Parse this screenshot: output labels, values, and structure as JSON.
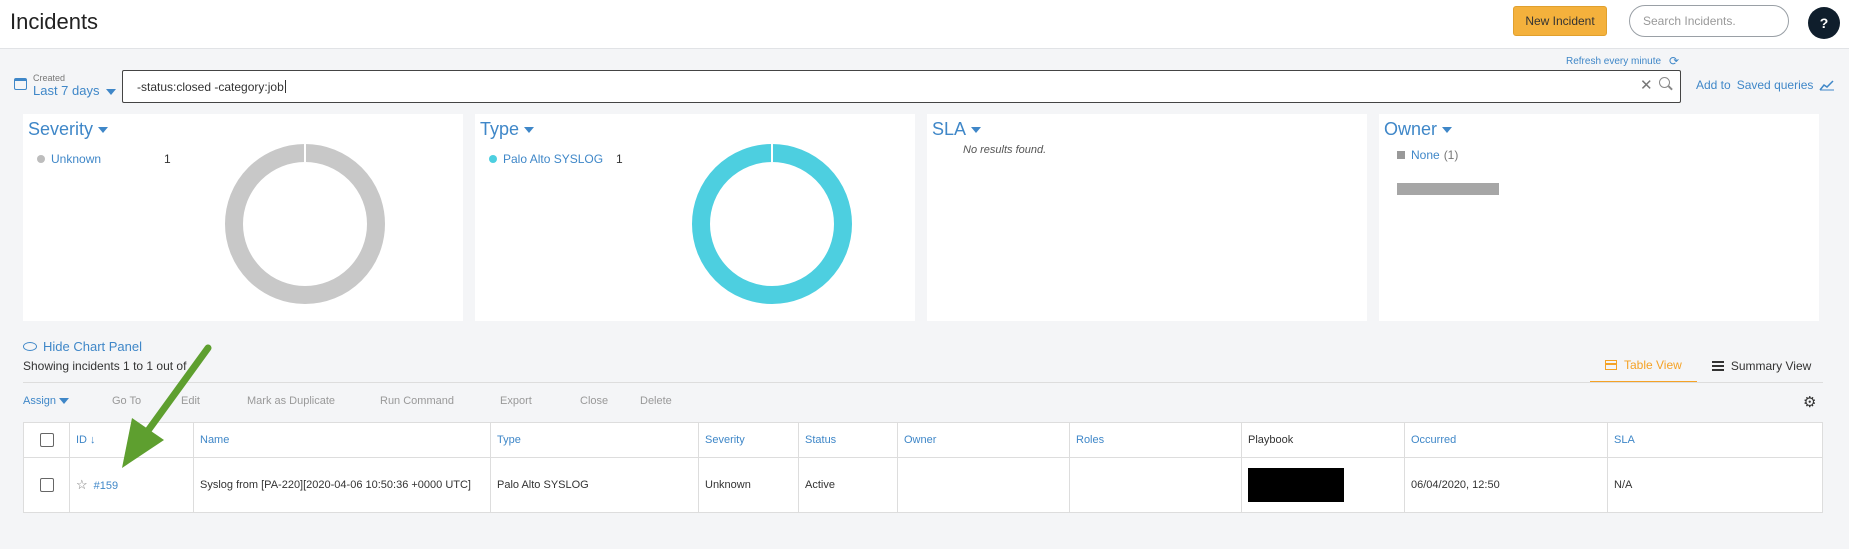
{
  "header": {
    "title": "Incidents",
    "new_button": "New Incident",
    "search_placeholder": "Search Incidents.",
    "help_label": "?"
  },
  "query_bar": {
    "refresh_label": "Refresh every minute",
    "created_label": "Created",
    "created_value": "Last 7 days",
    "query_text": "-status:closed -category:job",
    "add_to_label": "Add to",
    "saved_queries_label": "Saved queries"
  },
  "widgets": {
    "severity": {
      "title": "Severity",
      "legend": [
        {
          "label": "Unknown",
          "count": "1",
          "color": "#bdbdbd"
        }
      ],
      "donut_color": "#c8c8c8"
    },
    "type": {
      "title": "Type",
      "legend": [
        {
          "label": "Palo Alto SYSLOG",
          "count": "1",
          "color": "#4dcfe0"
        }
      ],
      "donut_color": "#4dcfe0"
    },
    "sla": {
      "title": "SLA",
      "empty_text": "No results found."
    },
    "owner": {
      "title": "Owner",
      "legend_label": "None",
      "legend_count": "(1)"
    }
  },
  "panel": {
    "hide_chart": "Hide Chart Panel",
    "showing": "Showing incidents 1 to 1 out of",
    "table_view": "Table View",
    "summary_view": "Summary View"
  },
  "actions": [
    "Assign",
    "Go To",
    "Edit",
    "Mark as Duplicate",
    "Run Command",
    "Export",
    "Close",
    "Delete"
  ],
  "table": {
    "columns": [
      "ID ↓",
      "Name",
      "Type",
      "Severity",
      "Status",
      "Owner",
      "Roles",
      "Playbook",
      "Occurred",
      "SLA"
    ],
    "rows": [
      {
        "id": "#159",
        "name": "Syslog from [PA-220][2020-04-06 10:50:36 +0000 UTC]",
        "type": "Palo Alto SYSLOG",
        "severity": "Unknown",
        "status": "Active",
        "owner": "",
        "roles": "",
        "playbook": "",
        "occurred": "06/04/2020, 12:50",
        "sla": "N/A"
      }
    ]
  },
  "colors": {
    "accent": "#3f87c8",
    "primary_button": "#f4b13c",
    "annotation_arrow": "#5e9f2f"
  }
}
